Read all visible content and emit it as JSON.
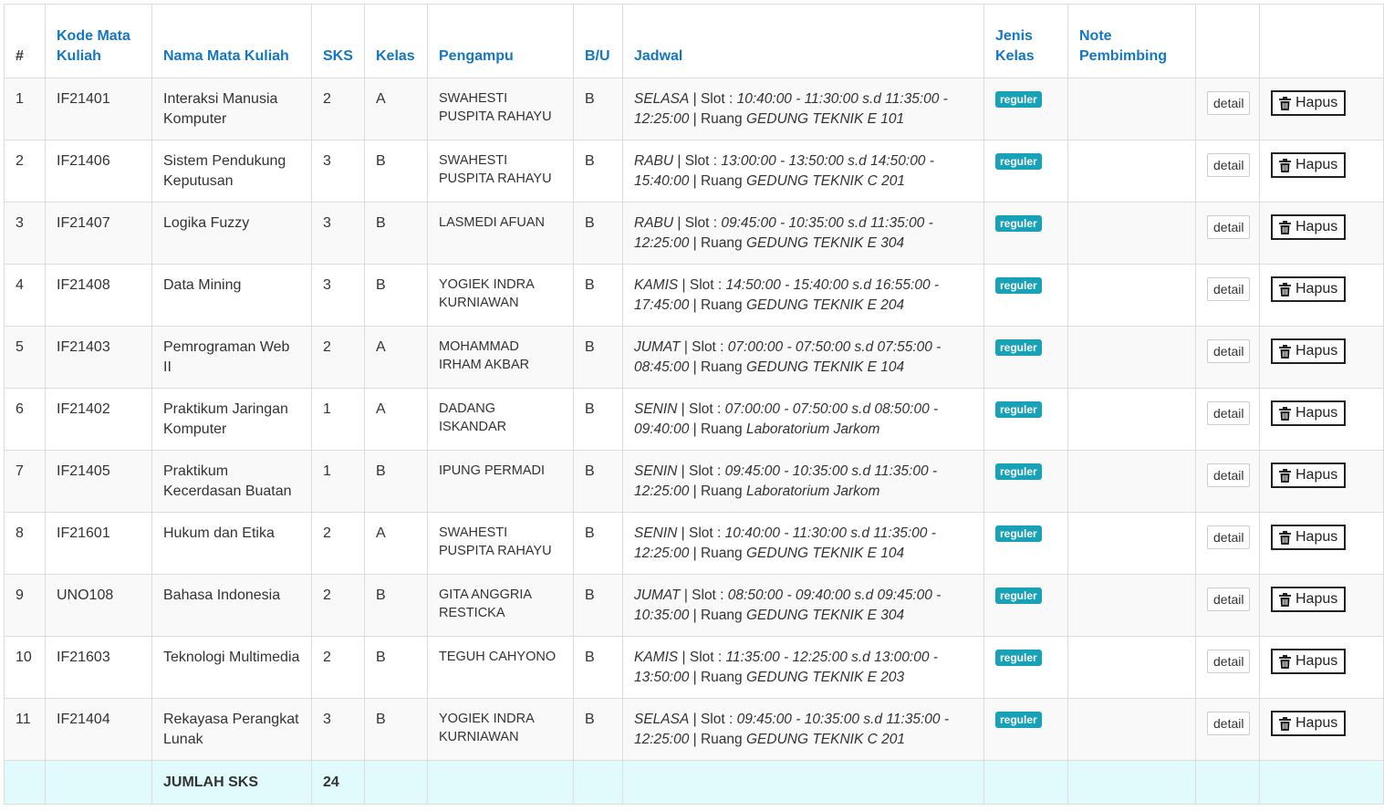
{
  "headers": {
    "num": "#",
    "kode": "Kode Mata Kuliah",
    "nama": "Nama Mata Kuliah",
    "sks": "SKS",
    "kelas": "Kelas",
    "pengampu": "Pengampu",
    "bu": "B/U",
    "jadwal": "Jadwal",
    "jenis": "Jenis Kelas",
    "note": "Note Pembimbing"
  },
  "buttons": {
    "detail": "detail",
    "hapus": "Hapus"
  },
  "rows": [
    {
      "no": "1",
      "kode": "IF21401",
      "nama": "Interaksi Manusia Komputer",
      "sks": "2",
      "kelas": "A",
      "pengampu": "SWAHESTI PUSPITA RAHAYU",
      "bu": "B",
      "hari": "SELASA",
      "slot": "10:40:00 - 11:30:00 s.d 11:35:00 - 12:25:00",
      "ruang": "GEDUNG TEKNIK E 101",
      "jenis": "reguler",
      "note": ""
    },
    {
      "no": "2",
      "kode": "IF21406",
      "nama": "Sistem Pendukung Keputusan",
      "sks": "3",
      "kelas": "B",
      "pengampu": "SWAHESTI PUSPITA RAHAYU",
      "bu": "B",
      "hari": "RABU",
      "slot": "13:00:00 - 13:50:00 s.d 14:50:00 - 15:40:00",
      "ruang": "GEDUNG TEKNIK C 201",
      "jenis": "reguler",
      "note": ""
    },
    {
      "no": "3",
      "kode": "IF21407",
      "nama": "Logika Fuzzy",
      "sks": "3",
      "kelas": "B",
      "pengampu": "LASMEDI AFUAN",
      "bu": "B",
      "hari": "RABU",
      "slot": "09:45:00 - 10:35:00 s.d 11:35:00 - 12:25:00",
      "ruang": "GEDUNG TEKNIK E 304",
      "jenis": "reguler",
      "note": ""
    },
    {
      "no": "4",
      "kode": "IF21408",
      "nama": "Data Mining",
      "sks": "3",
      "kelas": "B",
      "pengampu": "YOGIEK INDRA KURNIAWAN",
      "bu": "B",
      "hari": "KAMIS",
      "slot": "14:50:00 - 15:40:00 s.d 16:55:00 - 17:45:00",
      "ruang": "GEDUNG TEKNIK E 204",
      "jenis": "reguler",
      "note": ""
    },
    {
      "no": "5",
      "kode": "IF21403",
      "nama": "Pemrograman Web II",
      "sks": "2",
      "kelas": "A",
      "pengampu": "MOHAMMAD IRHAM AKBAR",
      "bu": "B",
      "hari": "JUMAT",
      "slot": "07:00:00 - 07:50:00 s.d 07:55:00 - 08:45:00",
      "ruang": "GEDUNG TEKNIK E 104",
      "jenis": "reguler",
      "note": ""
    },
    {
      "no": "6",
      "kode": "IF21402",
      "nama": "Praktikum Jaringan Komputer",
      "sks": "1",
      "kelas": "A",
      "pengampu": "DADANG ISKANDAR",
      "bu": "B",
      "hari": "SENIN",
      "slot": "07:00:00 - 07:50:00 s.d 08:50:00 - 09:40:00",
      "ruang": "Laboratorium Jarkom",
      "jenis": "reguler",
      "note": ""
    },
    {
      "no": "7",
      "kode": "IF21405",
      "nama": "Praktikum Kecerdasan Buatan",
      "sks": "1",
      "kelas": "B",
      "pengampu": "IPUNG PERMADI",
      "bu": "B",
      "hari": "SENIN",
      "slot": "09:45:00 - 10:35:00 s.d 11:35:00 - 12:25:00",
      "ruang": "Laboratorium Jarkom",
      "jenis": "reguler",
      "note": ""
    },
    {
      "no": "8",
      "kode": "IF21601",
      "nama": "Hukum dan Etika",
      "sks": "2",
      "kelas": "A",
      "pengampu": "SWAHESTI PUSPITA RAHAYU",
      "bu": "B",
      "hari": "SENIN",
      "slot": "10:40:00 - 11:30:00 s.d 11:35:00 - 12:25:00",
      "ruang": "GEDUNG TEKNIK E 104",
      "jenis": "reguler",
      "note": ""
    },
    {
      "no": "9",
      "kode": "UNO108",
      "nama": "Bahasa Indonesia",
      "sks": "2",
      "kelas": "B",
      "pengampu": "GITA ANGGRIA RESTICKA",
      "bu": "B",
      "hari": "JUMAT",
      "slot": "08:50:00 - 09:40:00 s.d 09:45:00 - 10:35:00",
      "ruang": "GEDUNG TEKNIK E 304",
      "jenis": "reguler",
      "note": ""
    },
    {
      "no": "10",
      "kode": "IF21603",
      "nama": "Teknologi Multimedia",
      "sks": "2",
      "kelas": "B",
      "pengampu": "TEGUH CAHYONO",
      "bu": "B",
      "hari": "KAMIS",
      "slot": "11:35:00 - 12:25:00 s.d 13:00:00 - 13:50:00",
      "ruang": "GEDUNG TEKNIK E 203",
      "jenis": "reguler",
      "note": ""
    },
    {
      "no": "11",
      "kode": "IF21404",
      "nama": "Rekayasa Perangkat Lunak",
      "sks": "3",
      "kelas": "B",
      "pengampu": "YOGIEK INDRA KURNIAWAN",
      "bu": "B",
      "hari": "SELASA",
      "slot": "09:45:00 - 10:35:00 s.d 11:35:00 - 12:25:00",
      "ruang": "GEDUNG TEKNIK C 201",
      "jenis": "reguler",
      "note": ""
    }
  ],
  "schedule_words": {
    "slot": "Slot :",
    "ruang": "Ruang"
  },
  "footer": {
    "label": "JUMLAH SKS",
    "total": "24"
  },
  "colors": {
    "header_text": "#1577c2",
    "badge": "#17a2b8",
    "footer_bg": "#e1fafc"
  },
  "icons": {
    "hapus": "trash-icon"
  }
}
